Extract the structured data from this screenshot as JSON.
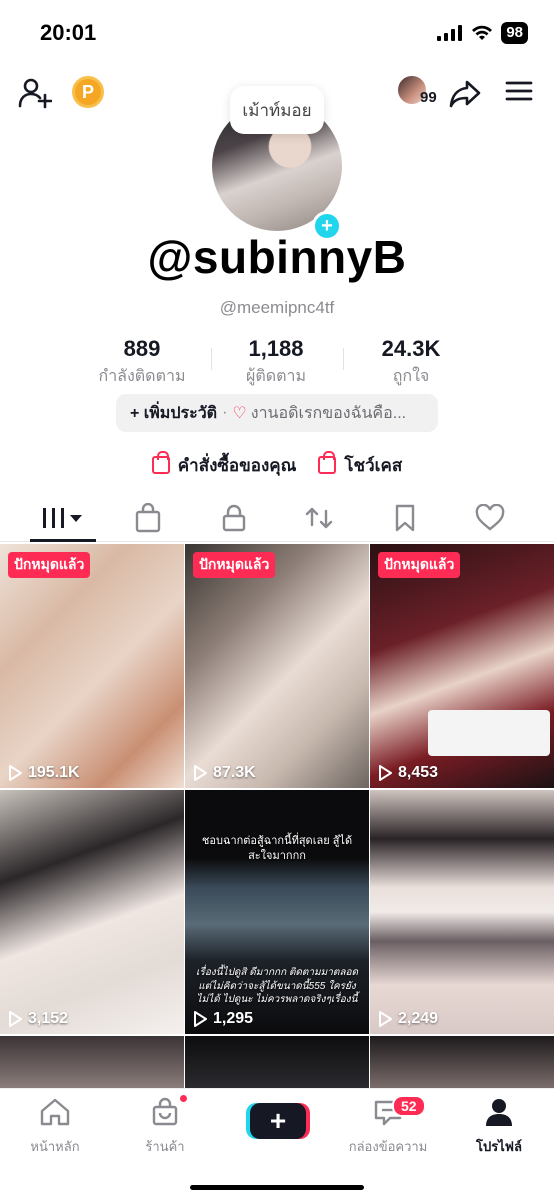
{
  "status_bar": {
    "time": "20:01",
    "battery": "98"
  },
  "header": {
    "viewer_count": "99",
    "coin_letter": "P"
  },
  "profile": {
    "bubble_text": "เม้าท์มอย",
    "username": "@subinnyB",
    "handle": "@meemipnc4tf",
    "stats": [
      {
        "value": "889",
        "label": "กำลังติดตาม"
      },
      {
        "value": "1,188",
        "label": "ผู้ติดตาม"
      },
      {
        "value": "24.3K",
        "label": "ถูกใจ"
      }
    ],
    "bio_add": "+ เพิ่มประวัติ",
    "bio_separator": "·",
    "bio_text": "งานอดิเรกของฉันคือ...",
    "links": {
      "orders": "คำสั่งซื้อของคุณ",
      "showcase": "โชว์เคส"
    }
  },
  "tabs": [
    "videos-icon",
    "shop-icon",
    "private-icon",
    "repost-icon",
    "favorites-icon",
    "liked-icon"
  ],
  "videos": [
    {
      "pinned": "ปักหมุดแล้ว",
      "views": "195.1K",
      "caption": ""
    },
    {
      "pinned": "ปักหมุดแล้ว",
      "views": "87.3K",
      "caption": ""
    },
    {
      "pinned": "ปักหมุดแล้ว",
      "views": "8,453",
      "caption": ""
    },
    {
      "pinned": "",
      "views": "3,152",
      "caption": ""
    },
    {
      "pinned": "",
      "views": "1,295",
      "caption_top": "ชอบฉากต่อสู้ฉากนี้ที่สุดเลย สู้ได้สะใจมากกก",
      "caption": "เรื่องนี้ไปดูสิ ดีมากกก ติดตามมาตลอด แต่ไม่คิดว่าจะสู้ได้ขนาดนี้555 ใครยังไม่ได้ ไปดูนะ ไม่ควรพลาดจริงๆเรื่องนี้"
    },
    {
      "pinned": "",
      "views": "2,249",
      "caption": ""
    }
  ],
  "bottom_nav": {
    "home": "หน้าหลัก",
    "shop": "ร้านค้า",
    "inbox": "กล่องข้อความ",
    "inbox_badge": "52",
    "profile": "โปรไฟล์"
  },
  "colors": {
    "accent": "#fe2c55",
    "cyan": "#20d5ec",
    "text": "#161823",
    "muted": "#8a8b91"
  }
}
